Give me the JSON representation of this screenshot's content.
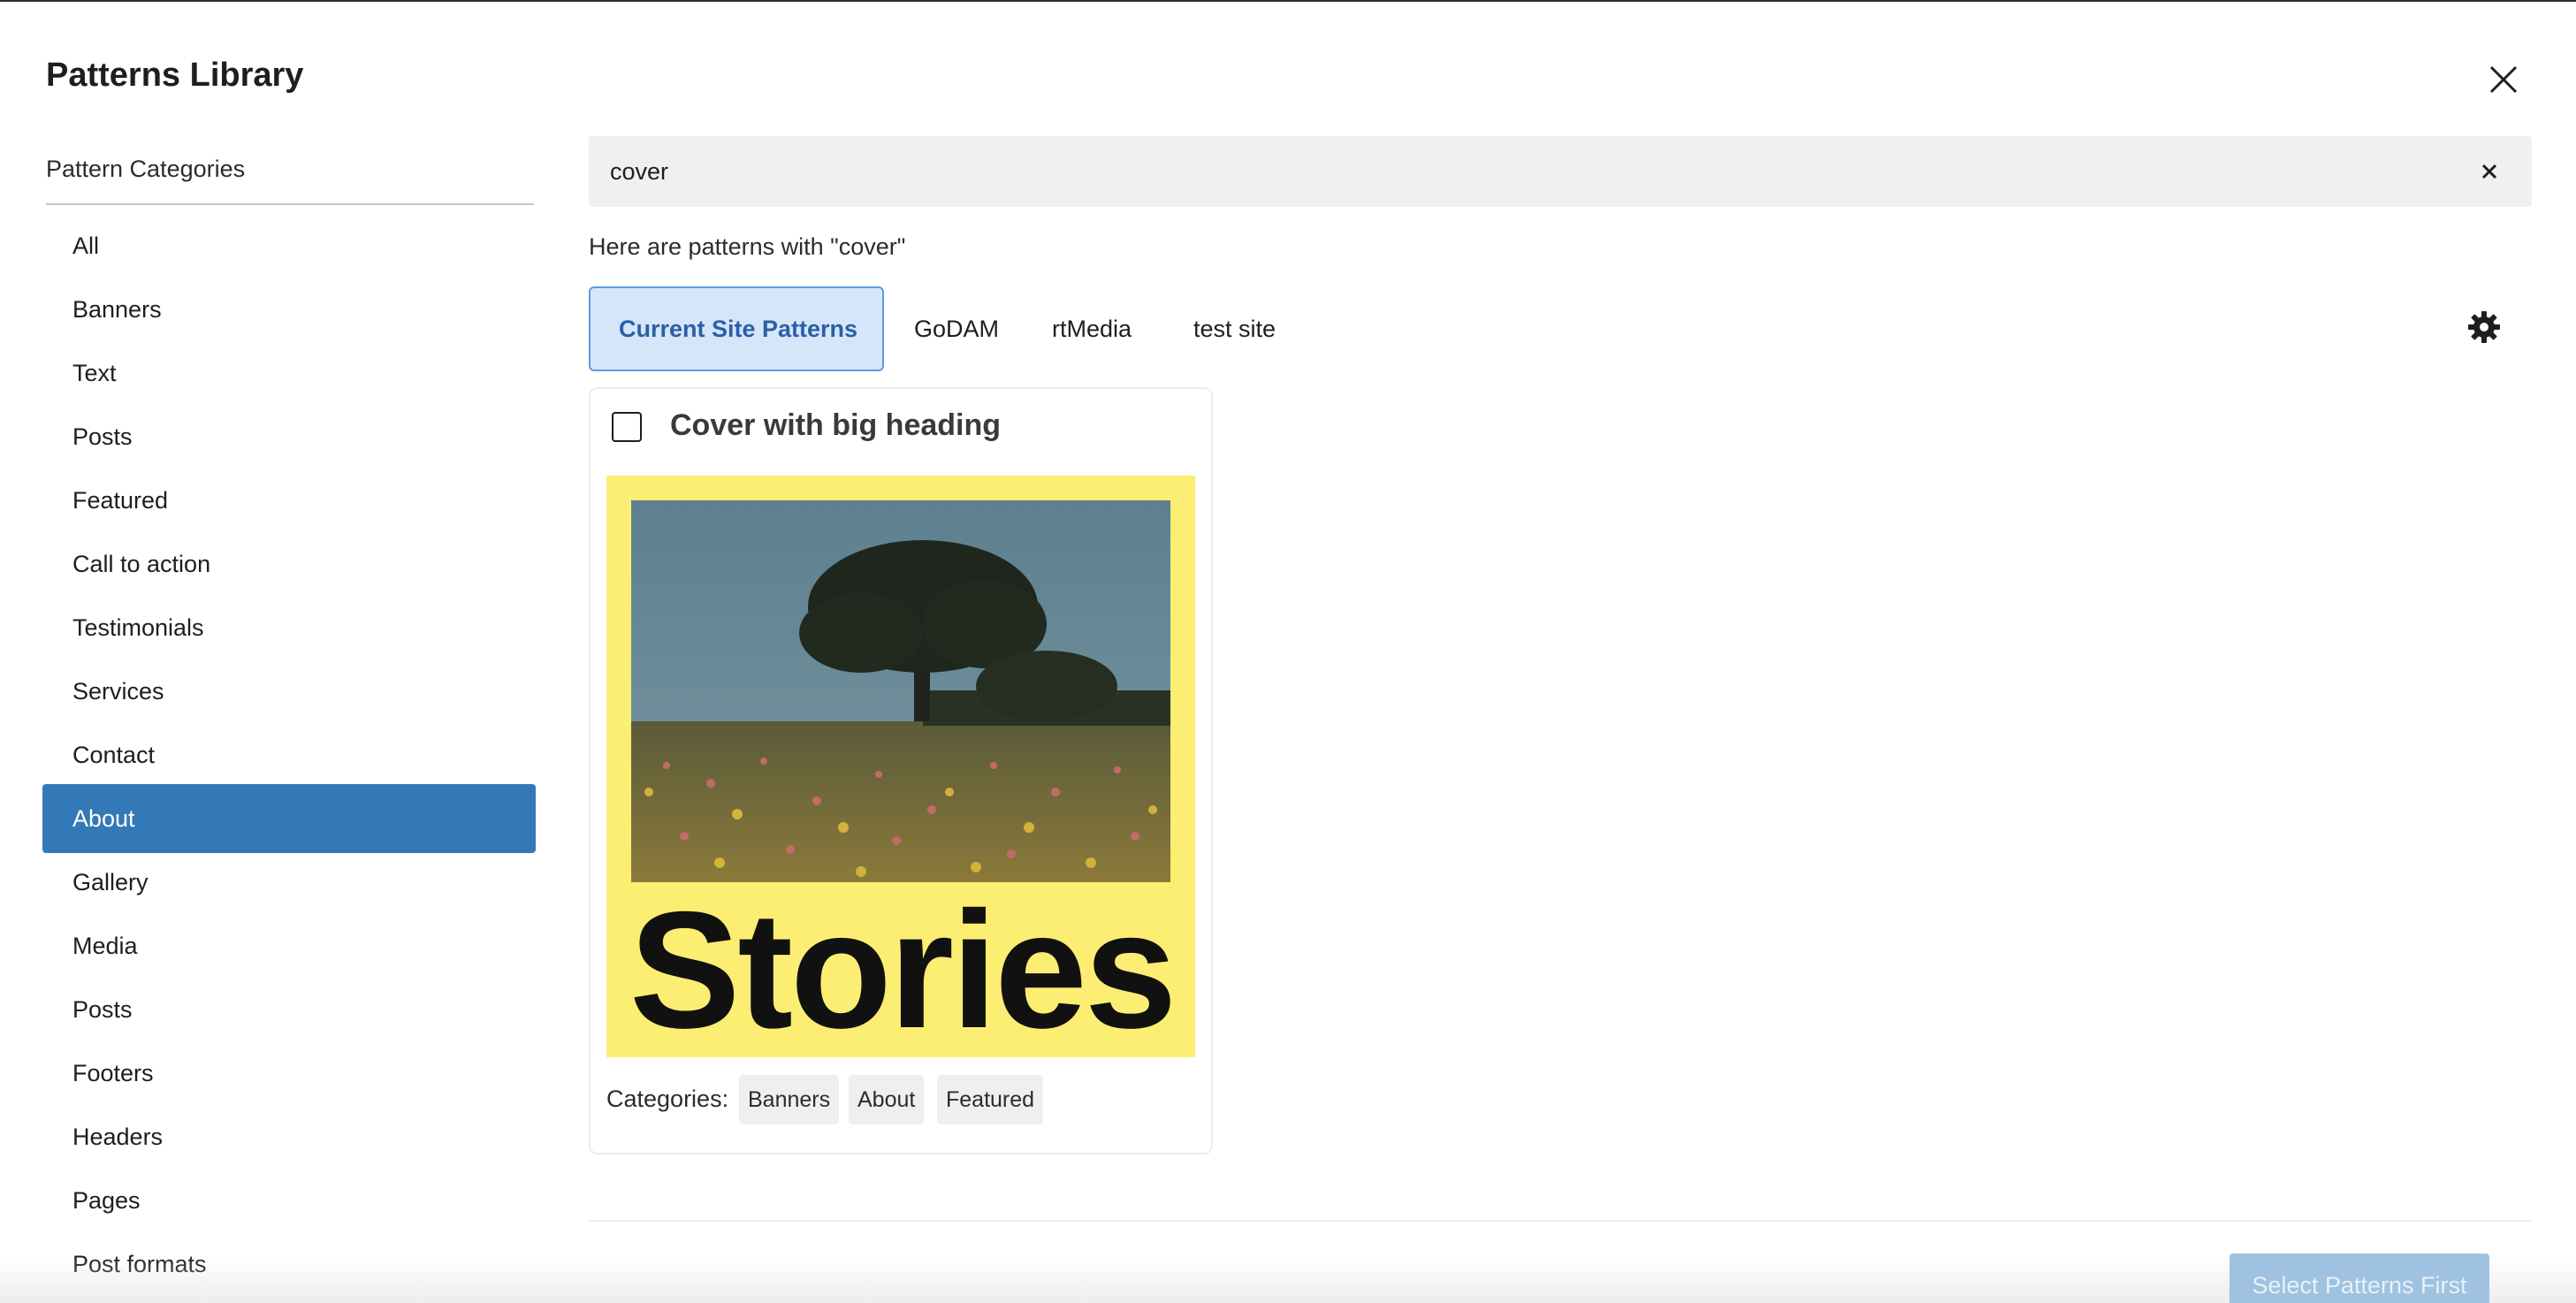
{
  "dialog": {
    "title": "Patterns Library"
  },
  "sidebar": {
    "heading": "Pattern Categories",
    "items": [
      {
        "label": "All"
      },
      {
        "label": "Banners"
      },
      {
        "label": "Text"
      },
      {
        "label": "Posts"
      },
      {
        "label": "Featured"
      },
      {
        "label": "Call to action"
      },
      {
        "label": "Testimonials"
      },
      {
        "label": "Services"
      },
      {
        "label": "Contact"
      },
      {
        "label": "About",
        "active": true
      },
      {
        "label": "Gallery"
      },
      {
        "label": "Media"
      },
      {
        "label": "Posts"
      },
      {
        "label": "Footers"
      },
      {
        "label": "Headers"
      },
      {
        "label": "Pages"
      },
      {
        "label": "Post formats"
      }
    ]
  },
  "search": {
    "value": "cover",
    "result_text": "Here are patterns with \"cover\""
  },
  "tabs": [
    {
      "label": "Current Site Patterns",
      "active": true
    },
    {
      "label": "GoDAM"
    },
    {
      "label": "rtMedia"
    },
    {
      "label": "test site"
    }
  ],
  "pattern": {
    "title": "Cover with big heading",
    "checked": false,
    "preview_text": "Stories",
    "categories_label": "Categories:",
    "categories": [
      "Banners",
      "About",
      "Featured"
    ]
  },
  "footer": {
    "select_label": "Select Patterns First"
  },
  "colors": {
    "accent": "#3379b7",
    "active_tab_bg": "#d5e6fb",
    "preview_bg": "#fcee72",
    "disabled_button": "#9fc2e0"
  },
  "icons": {
    "close": "close-icon",
    "clear_search": "clear-search-icon",
    "settings": "gear-icon",
    "checkbox": "checkbox-icon"
  }
}
